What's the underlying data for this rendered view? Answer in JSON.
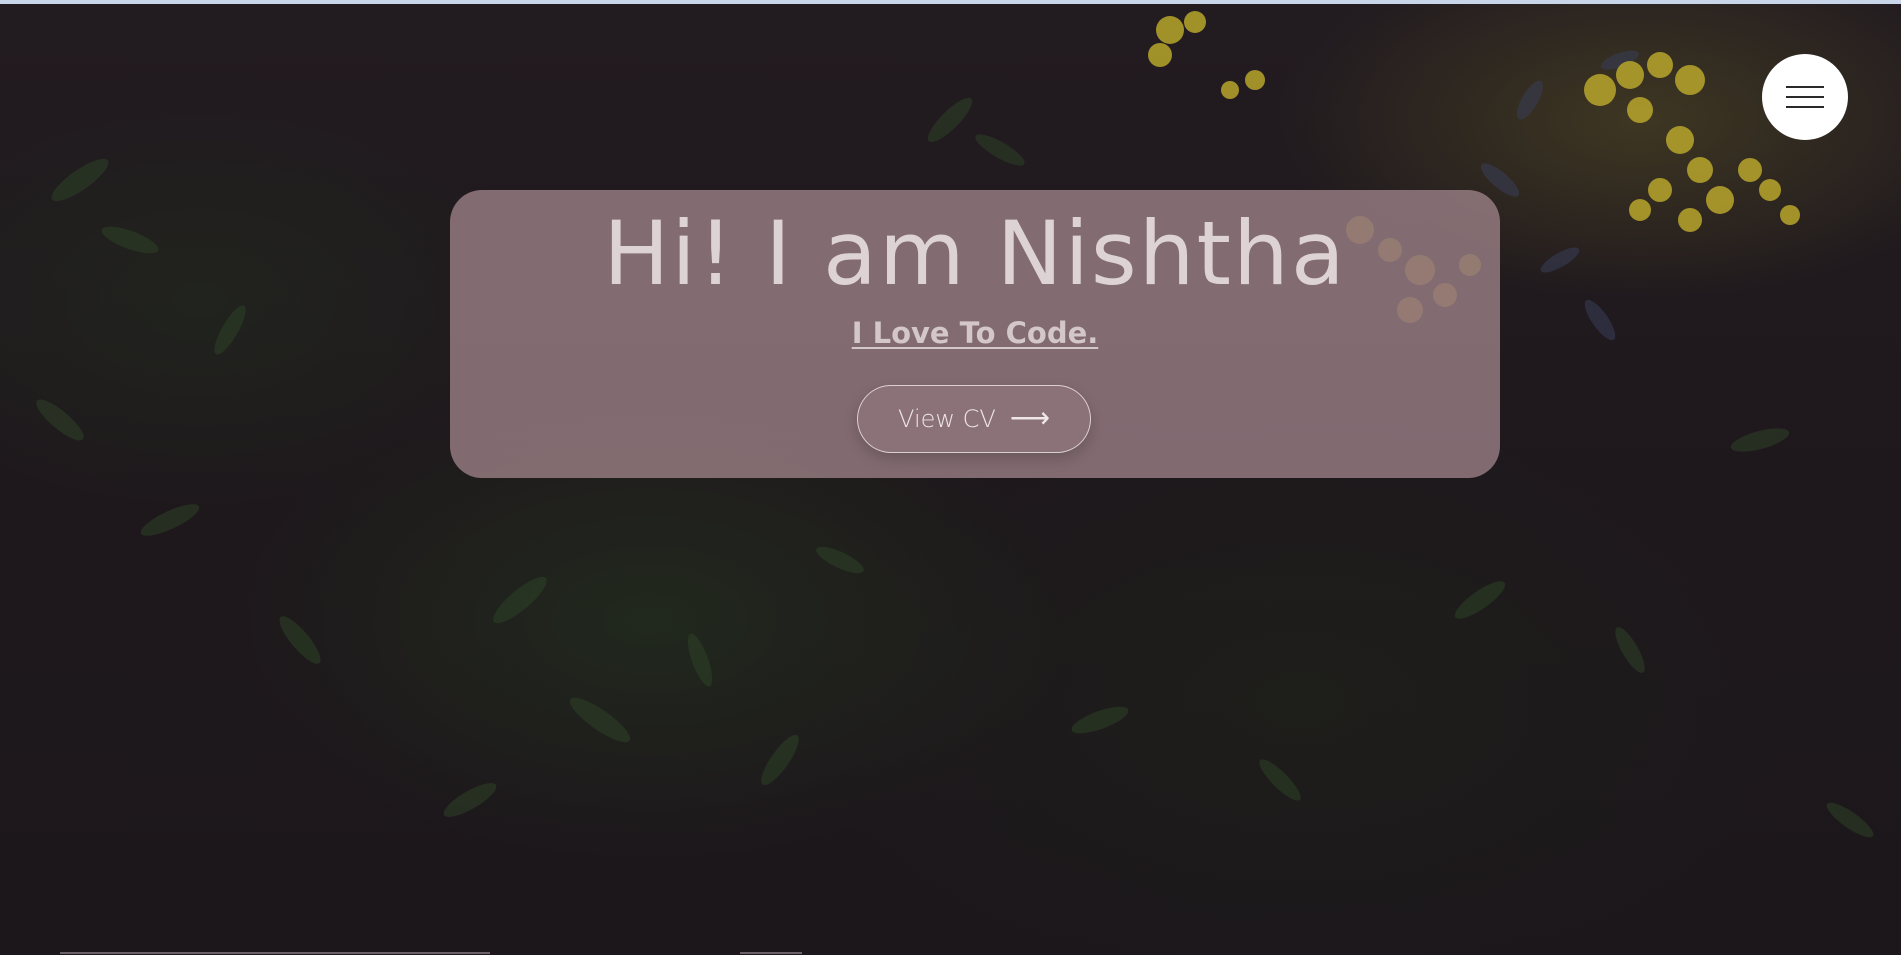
{
  "hero": {
    "title": "Hi! I am Nishtha",
    "subtitle": "I Love To Code.",
    "cv_button_label": "View CV",
    "cv_button_icon": "arrow-right-icon"
  },
  "nav": {
    "menu_icon": "hamburger-menu-icon"
  },
  "colors": {
    "card_background": "#a88a91",
    "title_text": "#ddd2d4",
    "menu_button_background": "#ffffff",
    "page_background": "#1d171b"
  }
}
